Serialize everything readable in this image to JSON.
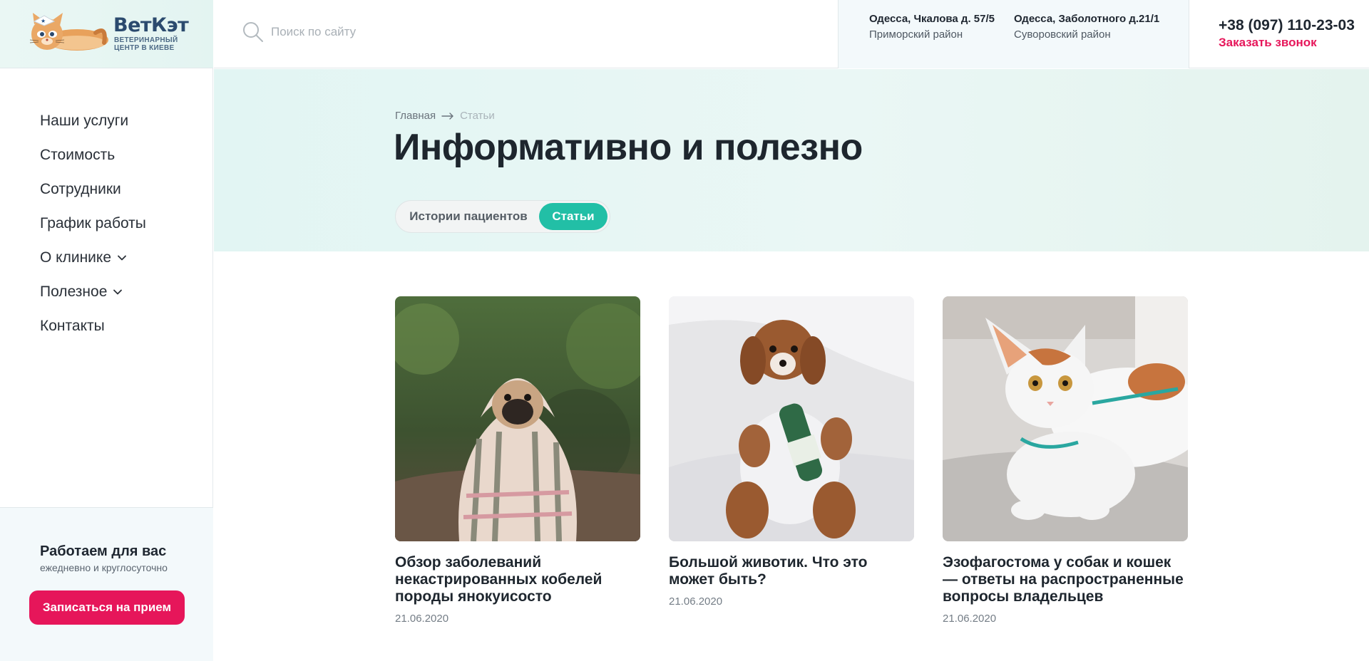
{
  "brand": {
    "name": "ВетКэт",
    "subtitle": "ВЕТЕРИНАРНЫЙ ЦЕНТР В КИЕВЕ"
  },
  "search": {
    "placeholder": "Поиск по сайту"
  },
  "addresses": [
    {
      "line1": "Одесса, Чкалова д. 57/5",
      "line2": "Приморский район"
    },
    {
      "line1": "Одесса, Заболотного д.21/1",
      "line2": "Суворовский район"
    }
  ],
  "contact": {
    "phone": "+38 (097) 110-23-03",
    "callback_label": "Заказать звонок"
  },
  "nav": {
    "items": [
      {
        "label": "Наши услуги"
      },
      {
        "label": "Стоимость"
      },
      {
        "label": "Сотрудники"
      },
      {
        "label": "График работы"
      },
      {
        "label": "О клинике"
      },
      {
        "label": "Полезное"
      },
      {
        "label": "Контакты"
      }
    ]
  },
  "sidebar_footer": {
    "title": "Работаем для вас",
    "subtitle": "ежедневно и круглосуточно",
    "button_label": "Записаться на прием"
  },
  "breadcrumb": {
    "home": "Главная",
    "current": "Статьи"
  },
  "page": {
    "title": "Информативно и полезно"
  },
  "tabs": {
    "items": [
      {
        "label": "Истории пациентов",
        "active": false
      },
      {
        "label": "Статьи",
        "active": true
      }
    ]
  },
  "articles": [
    {
      "title": "Обзор заболеваний некастрированных кобелей породы янокуисосто",
      "date": "21.06.2020",
      "image": "pug-in-blanket"
    },
    {
      "title": "Большой животик. Что это может быть?",
      "date": "21.06.2020",
      "image": "puppy-with-bottle"
    },
    {
      "title": "Эзофагостома у собак и кошек — ответы на распространенные вопросы владельцев",
      "date": "21.06.2020",
      "image": "white-cat"
    }
  ],
  "colors": {
    "accent": "#e6165a",
    "tab_active": "#22bfa6",
    "brand_text": "#2b4a6e",
    "hero_bg": "#e2f5f3"
  }
}
